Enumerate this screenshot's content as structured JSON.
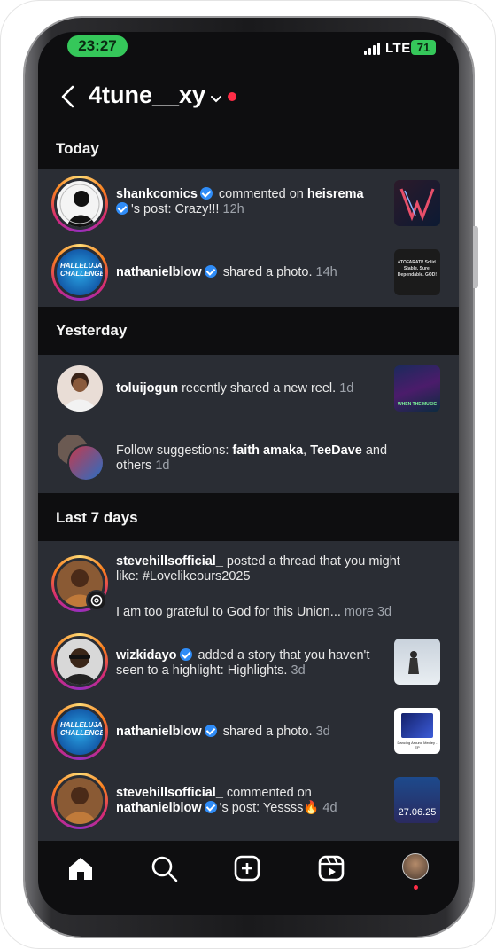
{
  "status_bar": {
    "time": "23:27",
    "network": "LTE",
    "battery": "71"
  },
  "header": {
    "account_name": "4tune__xy"
  },
  "sections": {
    "today": "Today",
    "yesterday": "Yesterday",
    "last7": "Last 7 days"
  },
  "notifications": {
    "n1": {
      "user": "shankcomics",
      "text1": " commented on ",
      "user2": "heisrema",
      "text2": "'s post: Crazy!!! ",
      "time": "12h"
    },
    "n2": {
      "user": "nathanielblow",
      "text1": " shared a photo. ",
      "time": "14h",
      "thumb_text": "ATOFARATI! Solid. Stable. Sure. Dependable. GOD!"
    },
    "n3": {
      "user": "toluijogun",
      "text1": " recently shared a new reel. ",
      "time": "1d",
      "thumb_text": "WHEN THE MUSIC"
    },
    "n4": {
      "text1": "Follow suggestions: ",
      "user": "faith amaka",
      "sep": ", ",
      "user2": "TeeDave",
      "text2": " and others ",
      "time": "1d"
    },
    "n5": {
      "user": "stevehillsofficial_",
      "text1": " posted a thread that you might like: #Lovelikeours2025",
      "text2": "I am too grateful to God for this Union... ",
      "more": "more",
      "time": "3d"
    },
    "n6": {
      "user": "wizkidayo",
      "text1": " added a story that you haven't seen to a highlight: Highlights. ",
      "time": "3d"
    },
    "n7": {
      "user": "nathanielblow",
      "text1": " shared a photo. ",
      "time": "3d",
      "thumb_text": "Dancing Around Medley - EP"
    },
    "n8": {
      "user": "stevehillsofficial_",
      "text1": " commented on ",
      "user2": "nathanielblow",
      "text2": "'s post: Yessss",
      "emoji": "🔥",
      "time": "4d",
      "thumb_text": "27.06.25"
    }
  },
  "avatar_text": {
    "challenge": "HALLELUJAH CHALLENGE"
  },
  "nav": {
    "items": [
      "home-icon",
      "search-icon",
      "create-icon",
      "reels-icon",
      "profile-avatar"
    ]
  },
  "colors": {
    "verified": "#2f8cf7",
    "accent_red": "#ff2d47",
    "status_green": "#35c75a"
  }
}
